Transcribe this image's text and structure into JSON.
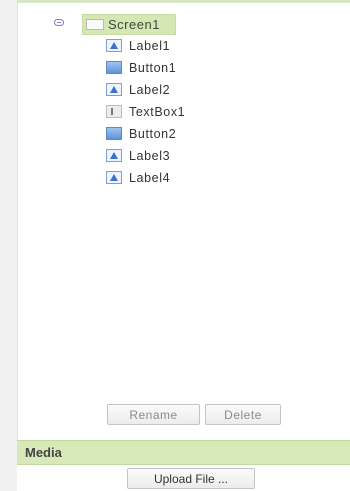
{
  "components": {
    "root": {
      "label": "Screen1",
      "icon": "screen-icon"
    },
    "children": [
      {
        "label": "Label1",
        "icon": "label-icon"
      },
      {
        "label": "Button1",
        "icon": "button-icon"
      },
      {
        "label": "Label2",
        "icon": "label-icon"
      },
      {
        "label": "TextBox1",
        "icon": "textbox-icon"
      },
      {
        "label": "Button2",
        "icon": "button-icon"
      },
      {
        "label": "Label3",
        "icon": "label-icon"
      },
      {
        "label": "Label4",
        "icon": "label-icon"
      }
    ],
    "rename_label": "Rename",
    "delete_label": "Delete"
  },
  "media": {
    "title": "Media",
    "upload_label": "Upload File ..."
  },
  "colors": {
    "selected_bg": "#d5e8b3",
    "panel_header_bg": "#d7e9b8"
  }
}
